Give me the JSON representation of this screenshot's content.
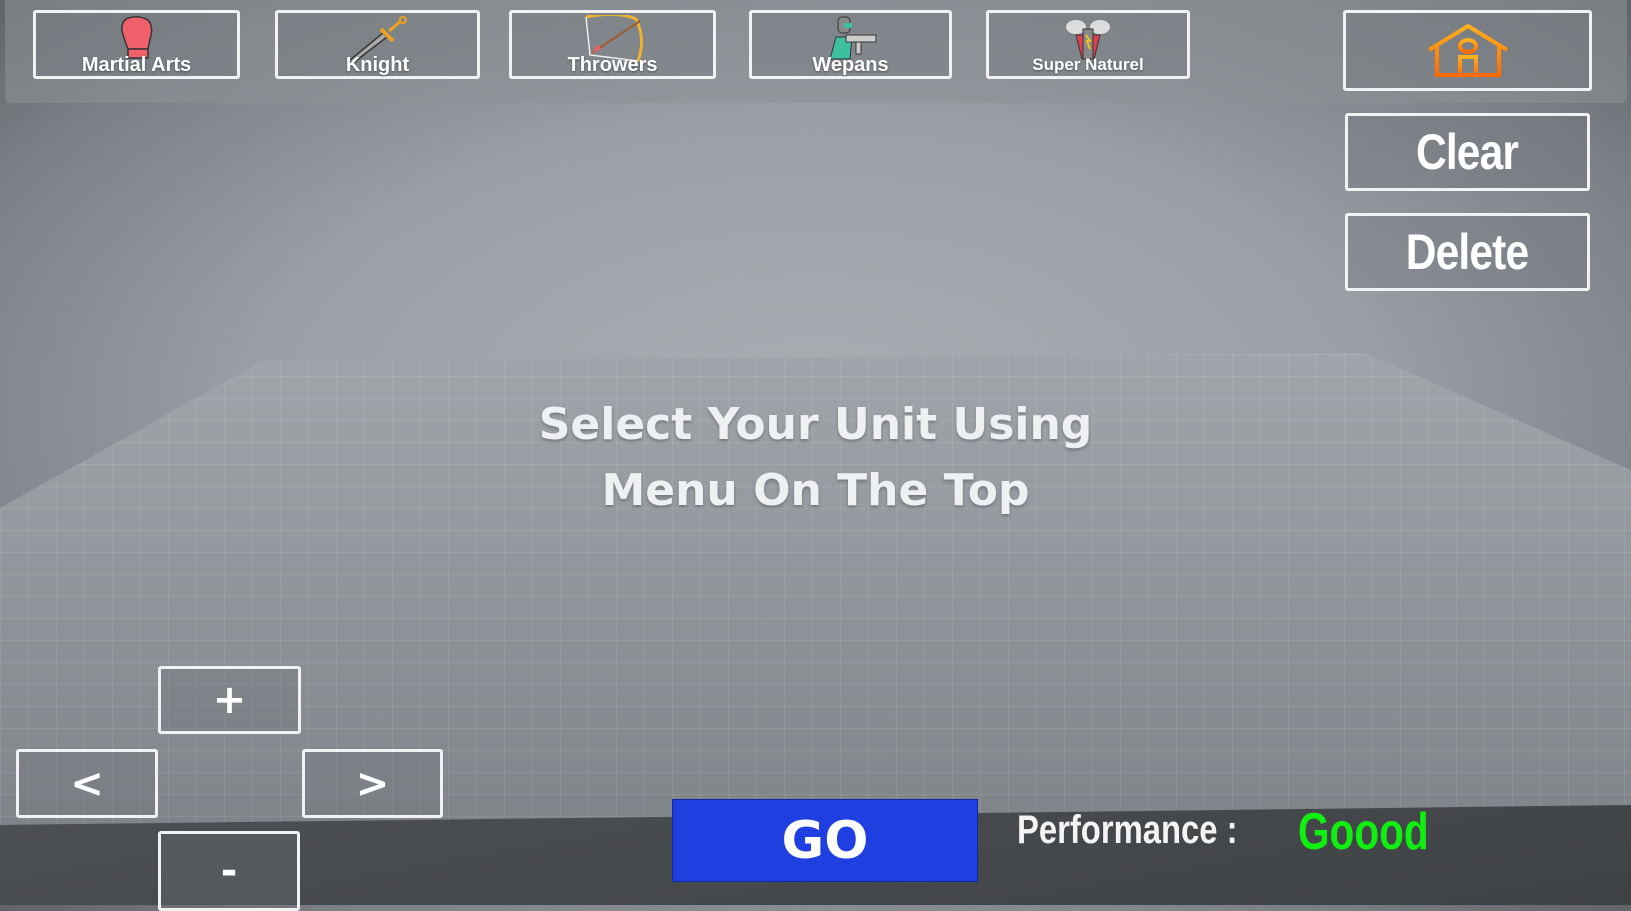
{
  "categories": [
    {
      "label": "Martial Arts",
      "icon": "boxing-glove-icon"
    },
    {
      "label": "Knight",
      "icon": "sword-icon"
    },
    {
      "label": "Throwers",
      "icon": "bow-arrow-icon"
    },
    {
      "label": "Wepans",
      "icon": "soldier-gun-icon"
    },
    {
      "label": "Super Naturel",
      "icon": "superhero-icon"
    }
  ],
  "side": {
    "home_icon": "home-icon",
    "clear": "Clear",
    "delete": "Delete"
  },
  "message": {
    "line1": "Select Your Unit Using",
    "line2": "Menu On The Top"
  },
  "camera": {
    "plus": "+",
    "left": "<",
    "right": ">",
    "minus": "-"
  },
  "go": "GO",
  "performance": {
    "label": "Performance :",
    "value": "Goood",
    "value_color": "#10f010"
  },
  "colors": {
    "go_button": "#1f3fe0",
    "home_icon": "#ff7a00"
  }
}
